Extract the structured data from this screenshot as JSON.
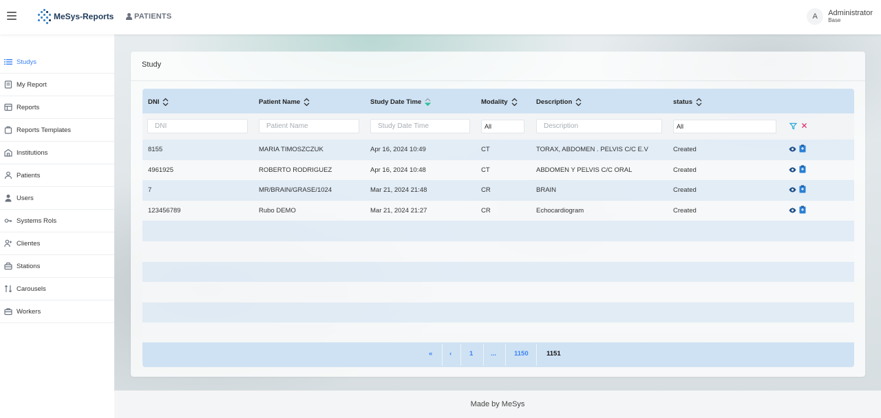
{
  "header": {
    "logo_text": "MeSys-Reports",
    "nav_label": "PATIENTS",
    "user": {
      "avatar_letter": "A",
      "name": "Administrator",
      "role": "Base"
    }
  },
  "sidebar": {
    "items": [
      {
        "label": "Studys",
        "icon": "list-icon",
        "active": true
      },
      {
        "label": "My Report",
        "icon": "report-icon",
        "active": false
      },
      {
        "label": "Reports",
        "icon": "table-icon",
        "active": false
      },
      {
        "label": "Reports Templates",
        "icon": "template-icon",
        "active": false
      },
      {
        "label": "Institutions",
        "icon": "institution-icon",
        "active": false
      },
      {
        "label": "Patients",
        "icon": "person-outline-icon",
        "active": false
      },
      {
        "label": "Users",
        "icon": "person-icon",
        "active": false
      },
      {
        "label": "Systems Rols",
        "icon": "key-icon",
        "active": false
      },
      {
        "label": "Clientes",
        "icon": "add-user-icon",
        "active": false
      },
      {
        "label": "Stations",
        "icon": "station-icon",
        "active": false
      },
      {
        "label": "Carousels",
        "icon": "swap-icon",
        "active": false
      },
      {
        "label": "Workers",
        "icon": "briefcase-icon",
        "active": false
      }
    ]
  },
  "card": {
    "title": "Study"
  },
  "table": {
    "columns": [
      "DNI",
      "Patient Name",
      "Study Date Time",
      "Modality",
      "Description",
      "status"
    ],
    "filters": {
      "dni_placeholder": "DNI",
      "patient_placeholder": "Patient Name",
      "date_placeholder": "Study Date Time",
      "modality_value": "All",
      "description_placeholder": "Description",
      "status_value": "All"
    },
    "rows": [
      {
        "dni": "8155",
        "patient": "MARIA TIMOSZCZUK",
        "date": "Apr 16, 2024 10:49",
        "modality": "CT",
        "description": "TORAX, ABDOMEN . PELVIS C/C E.V",
        "status": "Created"
      },
      {
        "dni": "4961925",
        "patient": "ROBERTO RODRIGUEZ",
        "date": "Apr 16, 2024 10:48",
        "modality": "CT",
        "description": "ABDOMEN Y PELVIS C/C ORAL",
        "status": "Created"
      },
      {
        "dni": "7",
        "patient": "MR/BRAIN/GRASE/1024",
        "date": "Mar 21, 2024 21:48",
        "modality": "CR",
        "description": "BRAIN",
        "status": "Created"
      },
      {
        "dni": "123456789",
        "patient": "Rubo DEMO",
        "date": "Mar 21, 2024 21:27",
        "modality": "CR",
        "description": "Echocardiogram",
        "status": "Created"
      }
    ]
  },
  "pagination": {
    "first": "«",
    "prev": "‹",
    "pages": [
      "1",
      "...",
      "1150",
      "1151"
    ],
    "current": "1151"
  },
  "footer": {
    "text": "Made by MeSys"
  },
  "colors": {
    "accent": "#3b82f6",
    "header_row": "#cfe2f3",
    "clear": "#e0245e"
  }
}
